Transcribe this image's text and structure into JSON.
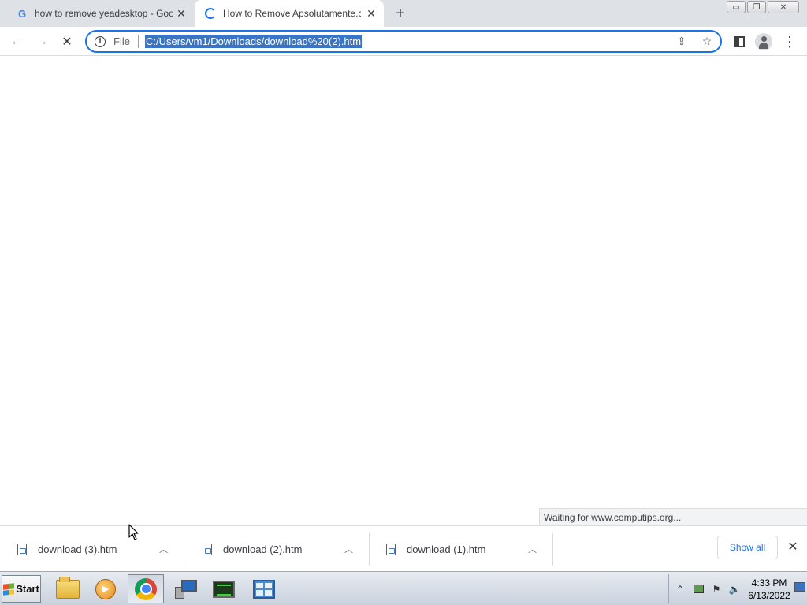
{
  "tabs": [
    {
      "title": "how to remove yeadesktop - Goo",
      "close": "✕",
      "favicon": "google-g-icon",
      "favicon_glyph": "G"
    },
    {
      "title": "How to Remove Apsolutamente.com",
      "close": "✕",
      "favicon": "loading-spinner-icon"
    }
  ],
  "new_tab": "+",
  "window_controls": {
    "minimize": "▭",
    "restore": "❐",
    "close": "✕"
  },
  "nav": {
    "back": "←",
    "forward": "→",
    "stop": "✕"
  },
  "omnibox": {
    "info_glyph": "i",
    "scheme": "File",
    "url": "C:/Users/vm1/Downloads/download%20(2).htm",
    "share_glyph": "⇪",
    "bookmark_glyph": "☆"
  },
  "toolbar": {
    "menu_glyph": "⋮"
  },
  "status_bubble": "Waiting for www.computips.org...",
  "downloads": {
    "items": [
      {
        "name": "download (3).htm",
        "chevron": "︿"
      },
      {
        "name": "download (2).htm",
        "chevron": "︿"
      },
      {
        "name": "download (1).htm",
        "chevron": "︿"
      }
    ],
    "show_all": "Show all",
    "close": "✕"
  },
  "taskbar": {
    "start_label": "Start",
    "tray": {
      "show_hidden": "⌃",
      "volume_glyph": "🔈",
      "flag_glyph": "⚑"
    },
    "time": "4:33 PM",
    "date": "6/13/2022"
  },
  "colors": {
    "accent": "#1a73e8",
    "selection": "#3a75c4",
    "tabstrip": "#dee1e6"
  }
}
